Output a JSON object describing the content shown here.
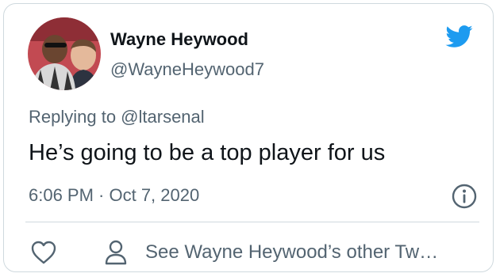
{
  "user": {
    "display_name": "Wayne Heywood",
    "handle": "@WayneHeywood7"
  },
  "tweet": {
    "replying_to": "Replying to @ltarsenal",
    "text": "He’s going to be a top player for us",
    "timestamp": "6:06 PM · Oct 7, 2020"
  },
  "actions": {
    "see_other": "See Wayne Heywood’s other Tw…"
  },
  "icons": {
    "brand": "twitter-bird-icon",
    "info": "info-icon",
    "like": "heart-icon",
    "profile": "person-icon"
  },
  "colors": {
    "brand_blue": "#1d9bf0",
    "secondary_text": "#536471",
    "primary_text": "#0f1419",
    "border": "#cfd9de"
  }
}
